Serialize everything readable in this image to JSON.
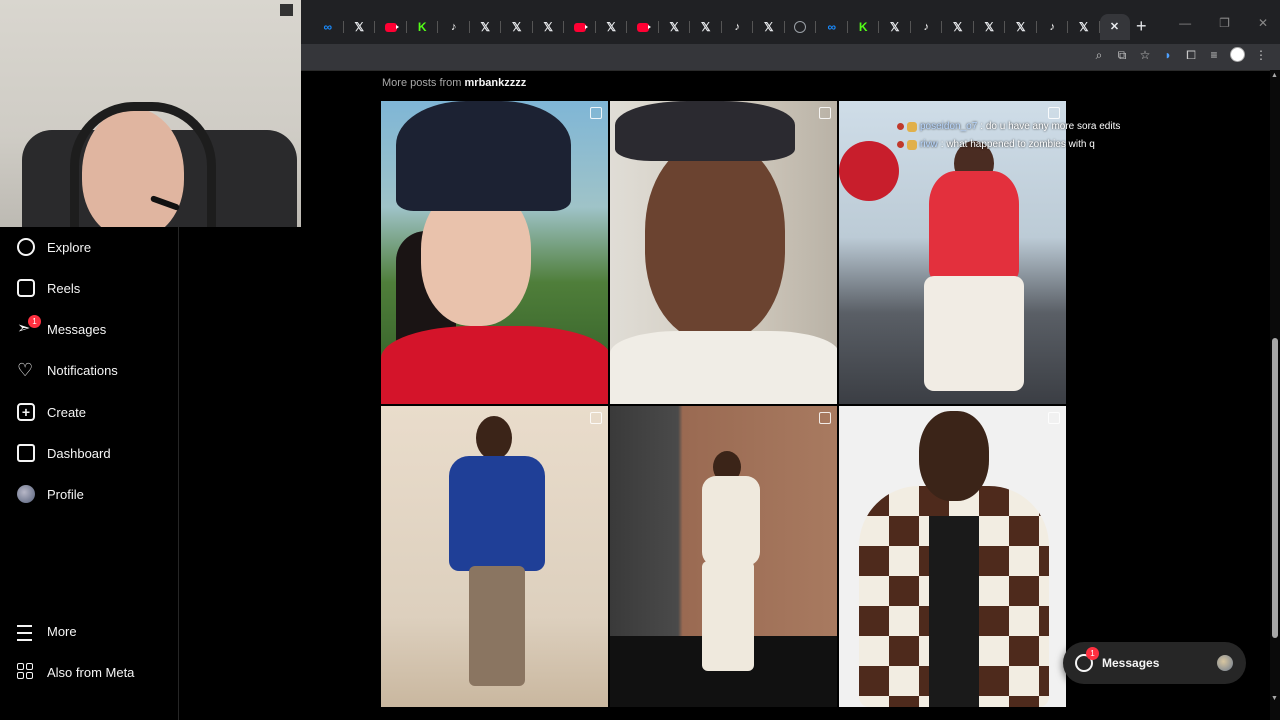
{
  "browser": {
    "tabs": [
      {
        "icon": "meta-icon",
        "glyph": "∞"
      },
      {
        "icon": "x-icon",
        "glyph": "𝕏"
      },
      {
        "icon": "youtube-icon",
        "glyph": ""
      },
      {
        "icon": "kick-icon",
        "glyph": "K"
      },
      {
        "icon": "tiktok-icon",
        "glyph": "♪"
      },
      {
        "icon": "x-icon",
        "glyph": "𝕏"
      },
      {
        "icon": "x-icon",
        "glyph": "𝕏"
      },
      {
        "icon": "x-icon",
        "glyph": "𝕏"
      },
      {
        "icon": "youtube-icon",
        "glyph": ""
      },
      {
        "icon": "x-icon",
        "glyph": "𝕏"
      },
      {
        "icon": "youtube-icon",
        "glyph": ""
      },
      {
        "icon": "x-icon",
        "glyph": "𝕏"
      },
      {
        "icon": "x-icon",
        "glyph": "𝕏"
      },
      {
        "icon": "tiktok-icon",
        "glyph": "♪"
      },
      {
        "icon": "x-icon",
        "glyph": "𝕏"
      },
      {
        "icon": "globe-icon",
        "glyph": ""
      },
      {
        "icon": "meta-icon",
        "glyph": "∞"
      },
      {
        "icon": "kick-icon",
        "glyph": "K"
      },
      {
        "icon": "x-icon",
        "glyph": "𝕏"
      },
      {
        "icon": "tiktok-icon",
        "glyph": "♪"
      },
      {
        "icon": "x-icon",
        "glyph": "𝕏"
      },
      {
        "icon": "x-icon",
        "glyph": "𝕏"
      },
      {
        "icon": "x-icon",
        "glyph": "𝕏"
      },
      {
        "icon": "tiktok-icon",
        "glyph": "♪"
      },
      {
        "icon": "x-icon",
        "glyph": "𝕏"
      }
    ],
    "active_tab_close": "✕",
    "new_tab": "+",
    "window_controls": [
      "—",
      "❐",
      "✕"
    ],
    "toolbar_icons": [
      "zoom-icon",
      "install-icon",
      "bookmark-star-icon",
      "extension-icon",
      "puzzle-icon",
      "media-icon",
      "profile-icon",
      "menu-dots-icon"
    ]
  },
  "sidebar": {
    "items": [
      {
        "id": "explore",
        "label": "Explore",
        "icon": "compass-icon"
      },
      {
        "id": "reels",
        "label": "Reels",
        "icon": "reels-icon"
      },
      {
        "id": "messages",
        "label": "Messages",
        "icon": "send-icon",
        "badge": "1"
      },
      {
        "id": "notifications",
        "label": "Notifications",
        "icon": "heart-icon"
      },
      {
        "id": "create",
        "label": "Create",
        "icon": "plus-icon"
      },
      {
        "id": "dashboard",
        "label": "Dashboard",
        "icon": "dashboard-icon"
      },
      {
        "id": "profile",
        "label": "Profile",
        "icon": "avatar"
      }
    ],
    "bottom": [
      {
        "id": "more",
        "label": "More",
        "icon": "menu-icon"
      },
      {
        "id": "also-meta",
        "label": "Also from Meta",
        "icon": "meta-apps-icon"
      }
    ]
  },
  "main": {
    "more_posts_prefix": "More posts from ",
    "username": "mrbankzzzz",
    "posts_count": 6
  },
  "overlay_comments": [
    {
      "user": "poseidon_o7",
      "text": ": do u have any more sora edits"
    },
    {
      "user": "rivw",
      "text": ": what happened to zombies with q"
    }
  ],
  "messages_bubble": {
    "label": "Messages",
    "badge": "1"
  },
  "colors": {
    "accent_badge": "#ff3040",
    "bg": "#000000",
    "panel": "#262626"
  }
}
